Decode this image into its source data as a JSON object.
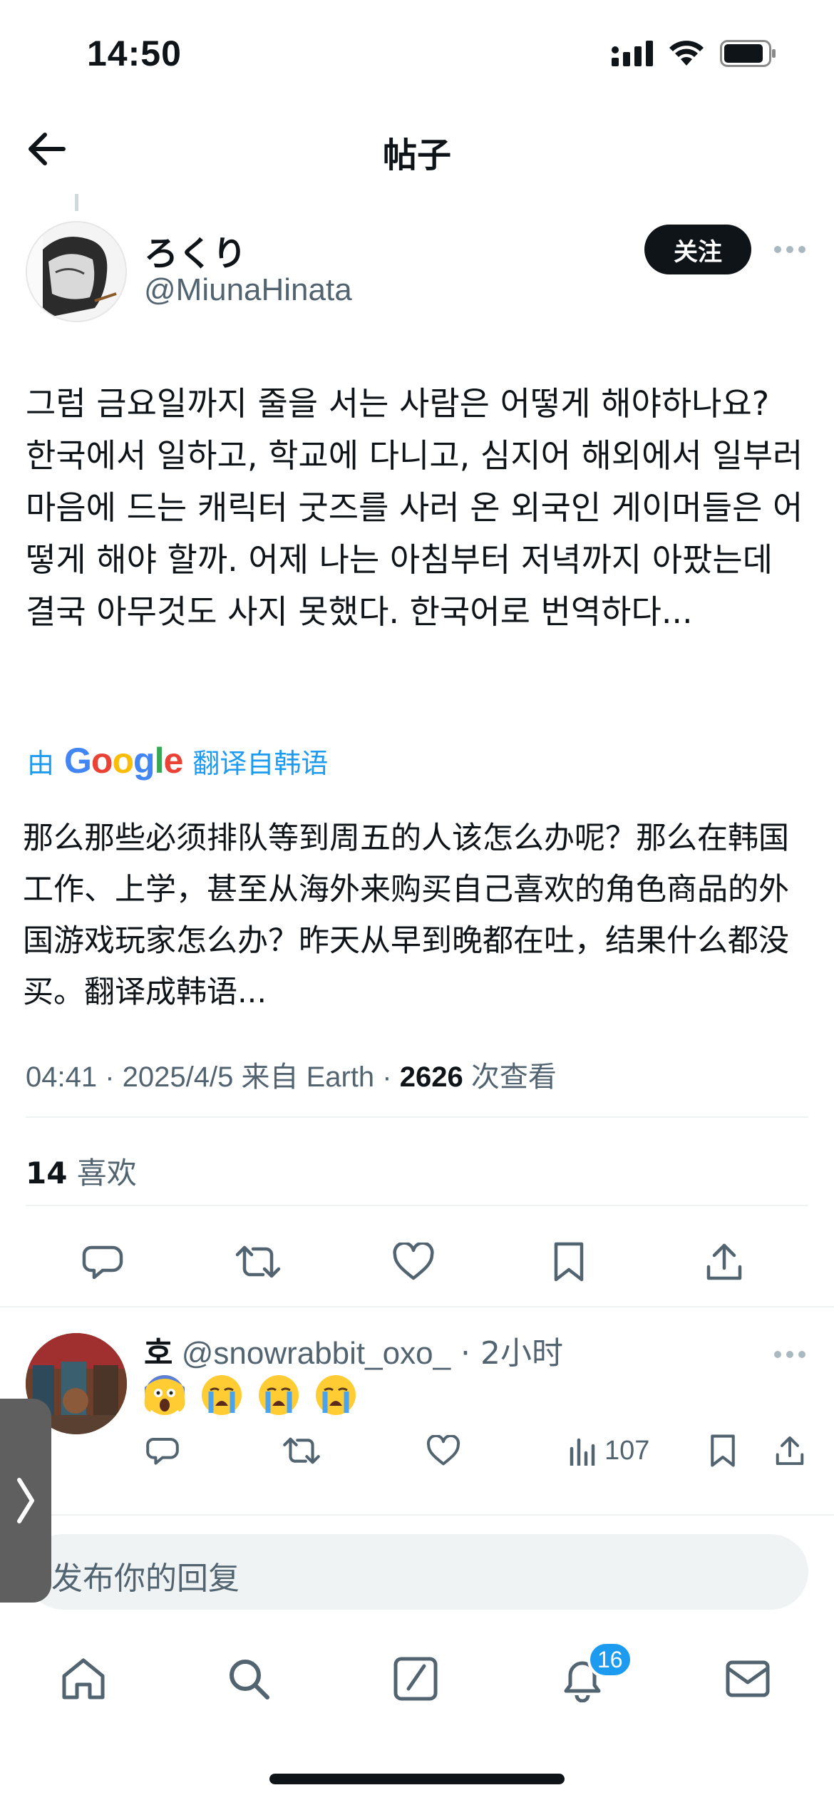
{
  "status_bar": {
    "time": "14:50"
  },
  "nav": {
    "title": "帖子"
  },
  "author": {
    "name": "ろくり",
    "handle": "@MiunaHinata",
    "follow_label": "关注"
  },
  "post": {
    "text": "그럼 금요일까지 줄을 서는 사람은 어떻게 해야하나요? 한국에서 일하고, 학교에 다니고, 심지어 해외에서 일부러 마음에 드는 캐릭터 굿즈를 사러 온 외국인 게이머들은 어떻게 해야 할까. 어제 나는 아침부터 저녁까지 아팠는데 결국 아무것도 사지 못했다. 한국어로 번역하다...",
    "translate_prefix": "由",
    "translate_brand": "Google",
    "translate_suffix": "翻译自韩语",
    "translated_text": "那么那些必须排队等到周五的人该怎么办呢？那么在韩国工作、上学，甚至从海外来购买自己喜欢的角色商品的外国游戏玩家怎么办？昨天从早到晚都在吐，结果什么都没买。翻译成韩语...",
    "meta_prefix": "04:41 · 2025/4/5 来自 Earth · ",
    "views_count": "2626",
    "views_label": " 次查看",
    "likes_count": "14",
    "likes_label": " 喜欢"
  },
  "reply": {
    "name": "호",
    "handle": " @snowrabbit_oxo_",
    "time": " · 2小时",
    "emoji": [
      "screaming-face",
      "loudly-crying-face",
      "loudly-crying-face",
      "loudly-crying-face"
    ],
    "views": "107"
  },
  "composer": {
    "placeholder": "发布你的回复"
  },
  "tab_bar": {
    "items": [
      "home-icon",
      "search-icon",
      "compose-icon",
      "notifications-icon",
      "messages-icon"
    ],
    "notification_badge": "16"
  },
  "colors": {
    "accent": "#1d9bf0",
    "text": "#0f1419",
    "secondary": "#536471"
  }
}
